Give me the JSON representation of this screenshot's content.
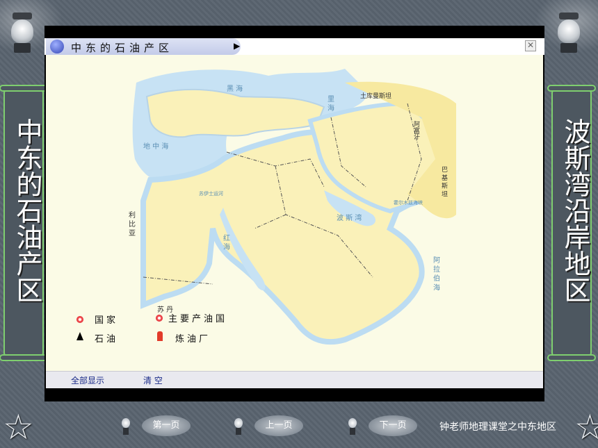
{
  "window": {
    "title": "中东的石油产区",
    "close_glyph": "✕"
  },
  "left_panel": {
    "text": "中东的石油产区"
  },
  "right_panel": {
    "text": "波斯湾沿岸地区"
  },
  "map_labels": {
    "black_sea": "黑 海",
    "caspian": "里 海",
    "turkmenistan": "土库曼斯坦",
    "afghanistan": "阿富汗",
    "pakistan": "巴 基 斯 坦",
    "mediterranean": "地 中 海",
    "libya": "利 比 亚",
    "sudan": "苏 丹",
    "red_sea": "红 海",
    "persian_gulf": "波 斯 湾",
    "arabian_sea": "阿 拉 伯 海",
    "hormuz": "霍尔木兹海峡",
    "suez": "苏伊士运河"
  },
  "legend": {
    "country": "国家",
    "major_oil_country": "主要产油国",
    "oil": "石油",
    "refinery": "炼油厂"
  },
  "footer": {
    "show_all": "全部显示",
    "clear": "清 空"
  },
  "nav": {
    "first": "第一页",
    "prev": "上一页",
    "next": "下一页"
  },
  "credit": "钟老师地理课堂之中东地区",
  "colors": {
    "land": "#faf1b9",
    "sea": "#c7e2f4",
    "coast": "#bcdcf2",
    "panel_border": "#7fcf6f"
  }
}
